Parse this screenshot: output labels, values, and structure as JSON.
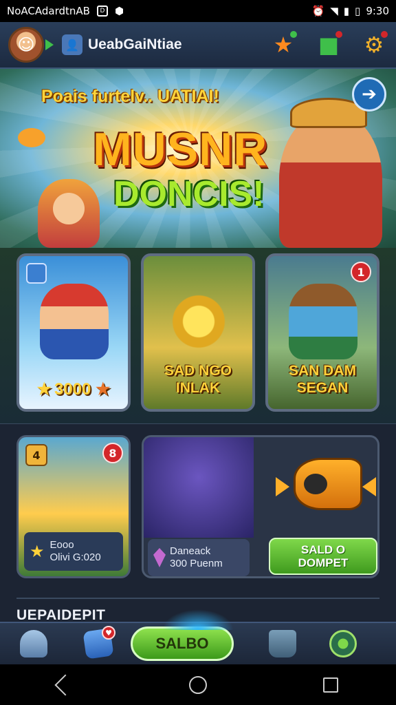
{
  "status_bar": {
    "carrier": "NoACAdardtnAB",
    "time": "9:30",
    "icons": [
      "sim-icon",
      "shield-icon",
      "alarm-icon",
      "wifi-icon",
      "signal-icon",
      "battery-icon"
    ]
  },
  "app_bar": {
    "user_name": "UeabGaiNtiae",
    "icons": [
      "star-icon",
      "gift-icon",
      "gear-icon"
    ],
    "accent": "#f2b12a"
  },
  "hero": {
    "subtitle": "Poais furtelv.. UATIAI!",
    "title_line1": "MUSNR",
    "title_line2": "DONCIS!",
    "next_icon": "arrow-right-icon"
  },
  "game_cards": [
    {
      "price": "3000",
      "icon": "crate-icon"
    },
    {
      "label_line1": "SAD NGO",
      "label_line2": "INLAK"
    },
    {
      "label_line1": "SAN DAM",
      "label_line2": "SEGAN",
      "badge": "1",
      "icon": "box-icon"
    }
  ],
  "promo": {
    "card1": {
      "icon_label": "4",
      "badge": "8",
      "info_line1": "Eooo",
      "info_line2": "Olivi G:020"
    },
    "card2": {
      "info_line1": "Daneack",
      "info_line2": "300 Puenm"
    },
    "saldo_button_line1": "SALD O",
    "saldo_button_line2": "DOMPET"
  },
  "section_title": "UEPAIDEPIT",
  "bottom_bar": {
    "saldo_label": "SALBO",
    "cube_badge": "♥",
    "items": [
      "robot-icon",
      "cube-icon",
      "saldo-button",
      "bucket-icon",
      "globe-icon"
    ]
  },
  "colors": {
    "primary_green": "#3f9a1e",
    "badge_red": "#d3262a",
    "gold_text": "#ffd23a"
  }
}
